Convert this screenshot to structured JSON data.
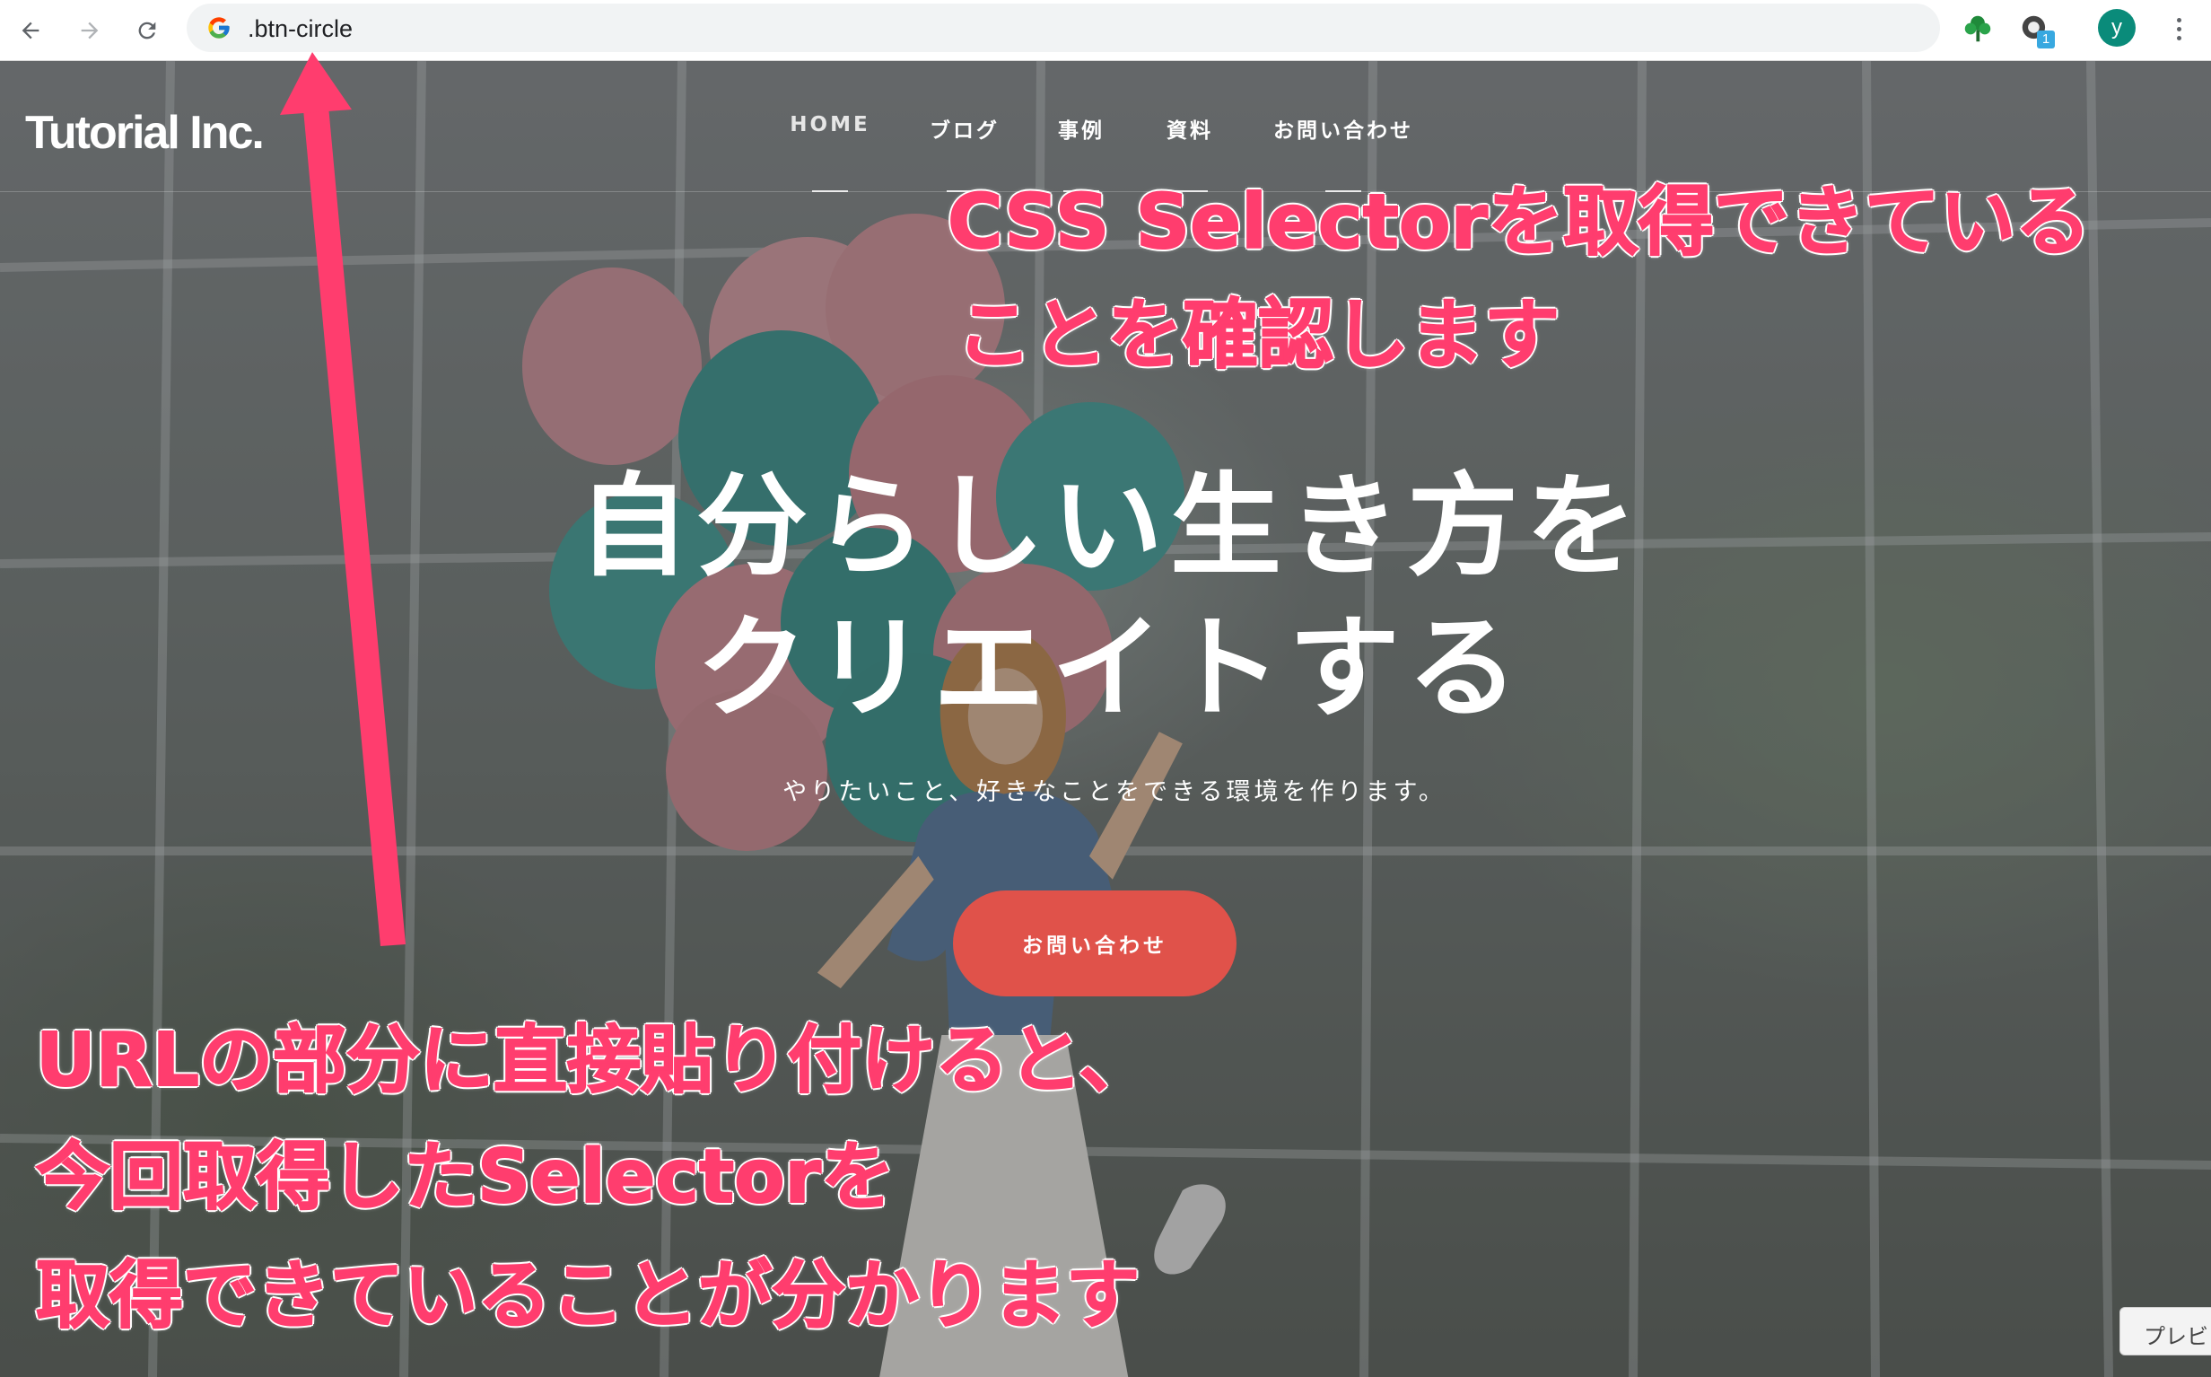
{
  "browser": {
    "omnibox_text": ".btn-circle",
    "back_icon": "back-arrow-icon",
    "forward_icon": "forward-arrow-icon",
    "reload_icon": "reload-icon",
    "avatar_letter": "y",
    "extension_badge": "1"
  },
  "site": {
    "logo": "Tutorial Inc.",
    "nav": [
      {
        "label": "HOME"
      },
      {
        "label": "ブログ"
      },
      {
        "label": "事例"
      },
      {
        "label": "資料"
      },
      {
        "label": "お問い合わせ"
      }
    ],
    "hero_title_line1": "自分らしい生き方を",
    "hero_title_line2": "クリエイトする",
    "hero_subtitle": "やりたいこと、好きなことをできる環境を作ります。",
    "cta_label": "お問い合わせ",
    "preview_tab": "プレビ"
  },
  "annotations": {
    "top_line1": "CSS Selectorを取得できている",
    "top_line2": "ことを確認します",
    "bottom_line1": "URLの部分に直接貼り付けると、",
    "bottom_line2": "今回取得したSelectorを",
    "bottom_line3": "取得できていることが分かります"
  },
  "colors": {
    "annotation": "#ff3d6e",
    "cta": "#e0524a",
    "avatar": "#0a8b7a"
  }
}
